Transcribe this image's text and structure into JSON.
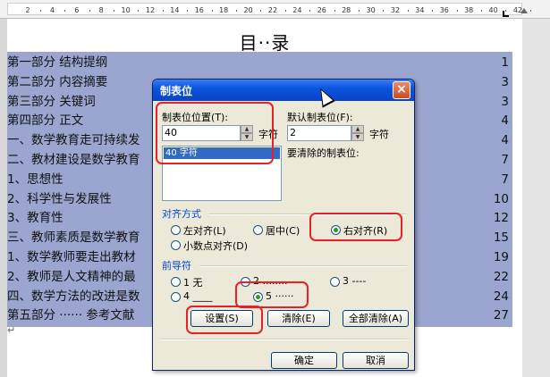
{
  "ruler": {
    "ticks": [
      "2",
      "4",
      "6",
      "8",
      "10",
      "12",
      "14",
      "16",
      "18",
      "20",
      "22",
      "24",
      "26",
      "28",
      "30",
      "32",
      "34",
      "36",
      "38",
      "40",
      "42"
    ]
  },
  "document": {
    "title": "目··录",
    "toc": [
      {
        "text": "第一部分   结构提纲",
        "page": "1"
      },
      {
        "text": "第二部分   内容摘要",
        "page": "3"
      },
      {
        "text": "第三部分   关键词",
        "page": "3"
      },
      {
        "text": "第四部分   正文",
        "page": "4"
      },
      {
        "text": "一、数学教育走可持续发",
        "page": "4"
      },
      {
        "text": "二、教材建设是数学教育",
        "page": "7"
      },
      {
        "text": "1、思想性",
        "page": "7"
      },
      {
        "text": "2、科学性与发展性",
        "page": "10"
      },
      {
        "text": "3、教育性",
        "page": "12"
      },
      {
        "text": "三、教师素质是数学教育",
        "page": "15"
      },
      {
        "text": "1、数学教师要走出教材",
        "page": "19"
      },
      {
        "text": "2、教师是人文精神的最",
        "page": "22"
      },
      {
        "text": "四、数学方法的改进是数",
        "page": "24"
      },
      {
        "text": "第五部分 ······ 参考文献",
        "page": "27"
      }
    ],
    "para_mark": "↵"
  },
  "dialog": {
    "title": "制表位",
    "close_symbol": "×",
    "tab_position_label": "制表位位置(T):",
    "tab_position_value": "40",
    "tab_position_unit": "字符",
    "default_tab_label": "默认制表位(F):",
    "default_tab_value": "2",
    "default_tab_unit": "字符",
    "tab_list": [
      "40 字符"
    ],
    "to_clear_label": "要清除的制表位:",
    "alignment": {
      "group_title": "对齐方式",
      "options": [
        "左对齐(L)",
        "居中(C)",
        "右对齐(R)",
        "小数点对齐(D)"
      ],
      "selected": "右对齐(R)"
    },
    "leader": {
      "group_title": "前导符",
      "options": [
        "1 无",
        "2 ........",
        "3 ----",
        "4 ____",
        "5 ······"
      ],
      "selected": "5 ······"
    },
    "buttons": {
      "set": "设置(S)",
      "clear": "清除(E)",
      "clear_all": "全部清除(A)",
      "ok": "确定",
      "cancel": "取消"
    }
  },
  "highlight_color": "#e8202a",
  "selection_color": "#9aa6d0"
}
